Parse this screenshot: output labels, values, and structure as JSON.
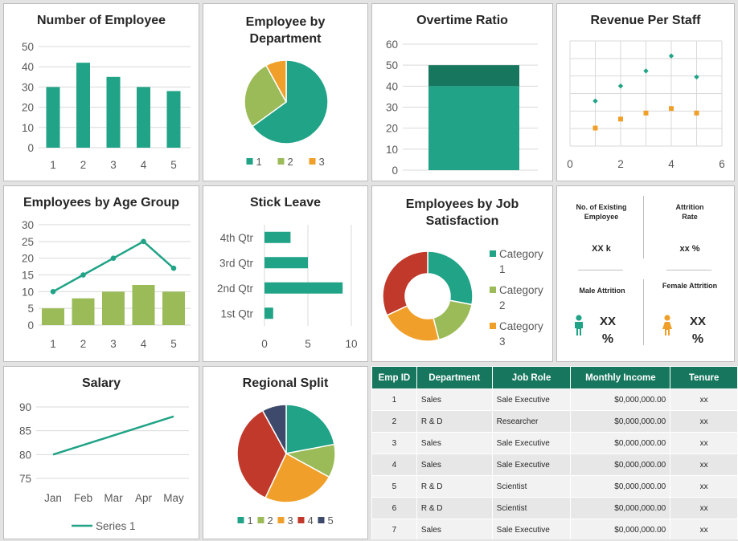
{
  "colors": {
    "teal": "#20a386",
    "teal_dark": "#17775e",
    "green": "#9bbb59",
    "orange": "#f0a02a",
    "red": "#c0392b",
    "navy": "#3e4a6b",
    "grid": "#d9d9d9"
  },
  "kpis": {
    "existing_label": "No. of Existing Employee",
    "existing_value": "XX k",
    "attrition_label": "Attrition Rate",
    "attrition_value": "xx %",
    "male_label": "Male Attrition",
    "male_value_1": "XX",
    "male_value_2": "%",
    "female_label": "Female Attrition",
    "female_value_1": "XX",
    "female_value_2": "%",
    "male_icon": "male-person-icon",
    "female_icon": "female-person-icon"
  },
  "table": {
    "headers": [
      "Emp ID",
      "Department",
      "Job Role",
      "Monthly Income",
      "Tenure"
    ],
    "rows": [
      [
        "1",
        "Sales",
        "Sale Executive",
        "$0,000,000.00",
        "xx"
      ],
      [
        "2",
        "R & D",
        "Researcher",
        "$0,000,000.00",
        "xx"
      ],
      [
        "3",
        "Sales",
        "Sale Executive",
        "$0,000,000.00",
        "xx"
      ],
      [
        "4",
        "Sales",
        "Sale Executive",
        "$0,000,000.00",
        "xx"
      ],
      [
        "5",
        "R & D",
        "Scientist",
        "$0,000,000.00",
        "xx"
      ],
      [
        "6",
        "R & D",
        "Scientist",
        "$0,000,000.00",
        "xx"
      ],
      [
        "7",
        "Sales",
        "Sale Executive",
        "$0,000,000.00",
        "xx"
      ]
    ]
  },
  "chart_data": [
    {
      "id": "num_employee",
      "type": "bar",
      "title": "Number of Employee",
      "categories": [
        "1",
        "2",
        "3",
        "4",
        "5"
      ],
      "values": [
        30,
        42,
        35,
        30,
        28
      ],
      "ylim": [
        0,
        50
      ],
      "yticks": [
        "0",
        "10",
        "20",
        "30",
        "40",
        "50"
      ],
      "grid": true
    },
    {
      "id": "dept",
      "type": "pie",
      "title": "Employee by Department",
      "labels": [
        "1",
        "2",
        "3"
      ],
      "values": [
        65,
        27,
        8
      ],
      "legend": "bottom"
    },
    {
      "id": "overtime",
      "type": "bar",
      "title": "Overtime Ratio",
      "categories": [
        ""
      ],
      "series": [
        {
          "values": [
            40
          ]
        },
        {
          "values": [
            10
          ]
        }
      ],
      "stacked": true,
      "ylim": [
        0,
        60
      ],
      "yticks": [
        "0",
        "10",
        "20",
        "30",
        "40",
        "50",
        "60"
      ],
      "grid": true
    },
    {
      "id": "revenue",
      "type": "scatter",
      "title": "Revenue Per Staff",
      "xlim": [
        0,
        6
      ],
      "xticks": [
        "0",
        "2",
        "4",
        "6"
      ],
      "series": [
        {
          "x": [
            1,
            2,
            3,
            4,
            5
          ],
          "y": [
            3.0,
            4.0,
            5.0,
            6.0,
            4.6
          ]
        },
        {
          "x": [
            1,
            2,
            3,
            4,
            5
          ],
          "y": [
            1.2,
            1.8,
            2.2,
            2.5,
            2.2
          ]
        }
      ],
      "ylim": [
        0,
        7
      ],
      "grid": true
    },
    {
      "id": "age",
      "type": "bar",
      "title": "Employees by Age Group",
      "categories": [
        "1",
        "2",
        "3",
        "4",
        "5"
      ],
      "series": [
        {
          "type": "bar",
          "values": [
            5,
            8,
            10,
            12,
            10
          ]
        },
        {
          "type": "line",
          "values": [
            10,
            15,
            20,
            25,
            17
          ]
        }
      ],
      "ylim": [
        0,
        30
      ],
      "yticks": [
        "0",
        "5",
        "10",
        "15",
        "20",
        "25",
        "30"
      ],
      "grid": true
    },
    {
      "id": "leave",
      "type": "bar",
      "orientation": "horizontal",
      "title": "Stick Leave",
      "categories": [
        "1st Qtr",
        "2nd Qtr",
        "3rd Qtr",
        "4th Qtr"
      ],
      "values": [
        1,
        9,
        5,
        3
      ],
      "xlim": [
        0,
        10
      ],
      "xticks": [
        "0",
        "5",
        "10"
      ],
      "grid": true
    },
    {
      "id": "satisfaction",
      "type": "pie",
      "donut": true,
      "title": "Employees by Job Satisfaction",
      "labels": [
        "Category 1",
        "Category 2",
        "Category 3"
      ],
      "values": [
        28,
        18,
        22,
        32
      ],
      "legend_labels": [
        [
          "Category",
          "1"
        ],
        [
          "Category",
          "2"
        ],
        [
          "Category",
          "3"
        ]
      ],
      "legend": "right"
    },
    {
      "id": "salary",
      "type": "line",
      "title": "Salary",
      "categories": [
        "Jan",
        "Feb",
        "Mar",
        "Apr",
        "May"
      ],
      "series": [
        {
          "name": "Series 1",
          "values": [
            80,
            82,
            84,
            86,
            88
          ]
        }
      ],
      "ylim": [
        75,
        90
      ],
      "yticks": [
        "75",
        "80",
        "85",
        "90"
      ],
      "legend": "bottom",
      "grid": true
    },
    {
      "id": "regional",
      "type": "pie",
      "title": "Regional Split",
      "labels": [
        "1",
        "2",
        "3",
        "4",
        "5"
      ],
      "values": [
        22,
        11,
        24,
        35,
        8
      ],
      "legend": "bottom"
    }
  ]
}
